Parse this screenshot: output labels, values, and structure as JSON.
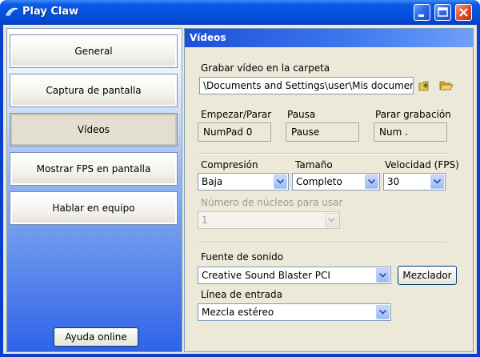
{
  "window": {
    "title": "Play Claw"
  },
  "sidebar": {
    "items": [
      {
        "label": "General"
      },
      {
        "label": "Captura de pantalla"
      },
      {
        "label": "Vídeos"
      },
      {
        "label": "Mostrar FPS en pantalla"
      },
      {
        "label": "Hablar en equipo"
      }
    ],
    "active": "Vídeos",
    "help_label": "Ayuda online"
  },
  "panel": {
    "header": "Vídeos",
    "folder": {
      "label": "Grabar vídeo en la carpeta",
      "value": "\\Documents and Settings\\user\\Mis documentos\\"
    },
    "hotkeys": [
      {
        "label": "Empezar/Parar",
        "value": "NumPad 0"
      },
      {
        "label": "Pausa",
        "value": "Pause"
      },
      {
        "label": "Parar grabación",
        "value": "Num ."
      }
    ],
    "compression": {
      "label": "Compresión",
      "value": "Baja"
    },
    "size": {
      "label": "Tamaño",
      "value": "Completo"
    },
    "speed": {
      "label": "Velocidad (FPS)",
      "value": "30"
    },
    "cores": {
      "label": "Número de núcleos para usar",
      "value": "1",
      "disabled": true
    },
    "sound_source": {
      "label": "Fuente de sonido",
      "value": "Creative Sound Blaster PCI"
    },
    "mixer_label": "Mezclador",
    "input_line": {
      "label": "Línea de entrada",
      "value": "Mezcla estéreo"
    }
  },
  "colors": {
    "titlebar": "#0453e0",
    "panel_header": "#1d4fd8",
    "client_bg": "#ece9d8"
  },
  "icons": [
    "app-icon",
    "minimize-icon",
    "maximize-icon",
    "close-icon",
    "folder-up-icon",
    "open-folder-icon",
    "chevron-down-icon"
  ]
}
